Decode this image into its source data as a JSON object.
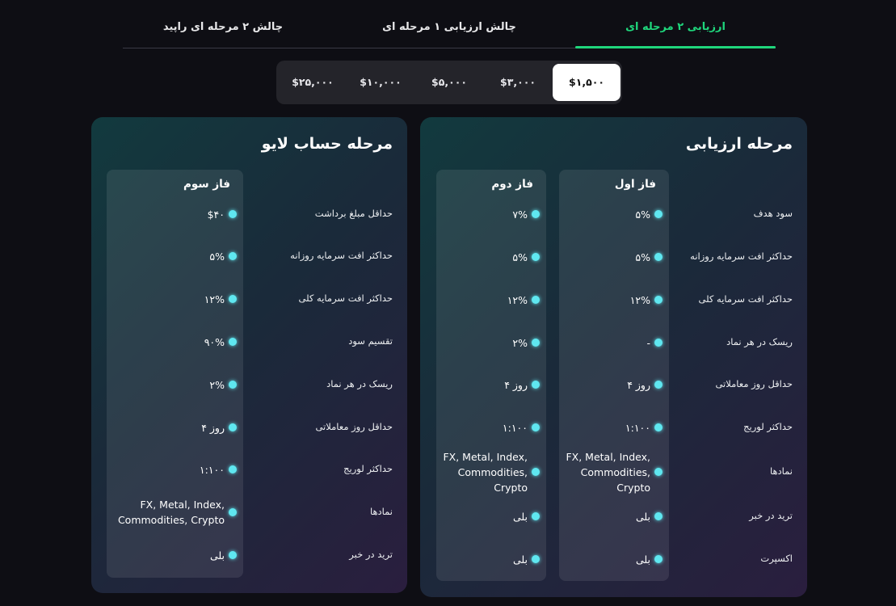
{
  "tabs": [
    {
      "label": "ارزیابی ۲ مرحله ای",
      "active": true
    },
    {
      "label": "چالش ارزیابی ۱ مرحله ای",
      "active": false
    },
    {
      "label": "چالش ۲ مرحله ای راپید",
      "active": false
    }
  ],
  "accent_color": "#1fd67c",
  "dot_color": "#5fe7f0",
  "amounts": [
    {
      "label": "$۱,۵۰۰",
      "selected": true
    },
    {
      "label": "$۳,۰۰۰",
      "selected": false
    },
    {
      "label": "$۵,۰۰۰",
      "selected": false
    },
    {
      "label": "$۱۰,۰۰۰",
      "selected": false
    },
    {
      "label": "$۲۵,۰۰۰",
      "selected": false
    }
  ],
  "evaluation": {
    "title": "مرحله ارزیابی",
    "rows": [
      "سود هدف",
      "حداکثر افت سرمایه روزانه",
      "حداکثر افت سرمایه کلی",
      "ریسک در هر نماد",
      "حداقل روز معاملاتی",
      "حداکثر لوریج",
      "نمادها",
      "ترید در خبر",
      "اکسپرت"
    ],
    "phase1": {
      "title": "فاز اول",
      "values": [
        "۵%",
        "۵%",
        "۱۲%",
        "-",
        "۴ روز",
        "۱:۱۰۰",
        "FX, Metal, Index, Commodities, Crypto",
        "بلی",
        "بلی"
      ]
    },
    "phase2": {
      "title": "فاز دوم",
      "values": [
        "۷%",
        "۵%",
        "۱۲%",
        "۲%",
        "۴ روز",
        "۱:۱۰۰",
        "FX, Metal, Index, Commodities, Crypto",
        "بلی",
        "بلی"
      ]
    }
  },
  "live": {
    "title": "مرحله حساب لایو",
    "rows": [
      "حداقل مبلغ برداشت",
      "حداکثر افت سرمایه روزانه",
      "حداکثر افت سرمایه کلی",
      "تقسیم سود",
      "ریسک در هر نماد",
      "حداقل روز معاملاتی",
      "حداکثر لوریج",
      "نمادها",
      "ترید در خبر"
    ],
    "phase3": {
      "title": "فاز سوم",
      "values": [
        "$۴۰",
        "۵%",
        "۱۲%",
        "۹۰%",
        "۲%",
        "۴ روز",
        "۱:۱۰۰",
        "FX, Metal, Index, Commodities, Crypto",
        "بلی"
      ]
    }
  }
}
